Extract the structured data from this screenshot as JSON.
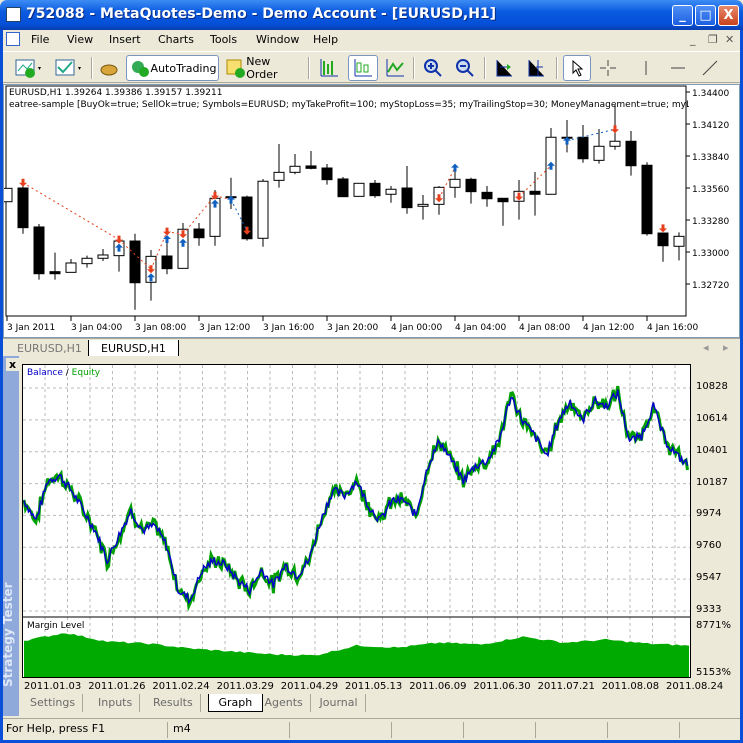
{
  "window": {
    "title": "752088 - MetaQuotes-Demo - Demo Account - [EURUSD,H1]",
    "minimize": "_",
    "maximize": "□",
    "close": "X"
  },
  "menu": [
    "File",
    "View",
    "Insert",
    "Charts",
    "Tools",
    "Window",
    "Help"
  ],
  "toolbar": {
    "autotrading": "AutoTrading",
    "new_order": "New Order"
  },
  "chart": {
    "header": "EURUSD,H1  1.39264 1.39386 1.39157 1.39211",
    "ea_line": "eatree-sample [BuyOk=true; SellOk=true; Symbols=EURUSD; myTakeProfit=100; myStopLoss=35; myTrailingStop=30; MoneyManagement=true; myLots=0.1",
    "price_ticks": [
      "1.34400",
      "1.34120",
      "1.33840",
      "1.33560",
      "1.33280",
      "1.33000",
      "1.32720"
    ],
    "price_range": [
      1.3272,
      1.344
    ],
    "time_ticks": [
      "3 Jan 2011",
      "3 Jan 04:00",
      "3 Jan 08:00",
      "3 Jan 12:00",
      "3 Jan 16:00",
      "3 Jan 20:00",
      "4 Jan 00:00",
      "4 Jan 04:00",
      "4 Jan 08:00",
      "4 Jan 12:00",
      "4 Jan 16:00"
    ],
    "candles": [
      [
        1.3344,
        1.3356,
        1.3344,
        1.33557
      ],
      [
        1.3356,
        1.33601,
        1.3316,
        1.33213
      ],
      [
        1.33219,
        1.33245,
        1.32758,
        1.3281
      ],
      [
        1.32828,
        1.32994,
        1.32758,
        1.3281
      ],
      [
        1.32822,
        1.32939,
        1.32822,
        1.32904
      ],
      [
        1.32898,
        1.32968,
        1.32863,
        1.32945
      ],
      [
        1.32945,
        1.33026,
        1.32921,
        1.32974
      ],
      [
        1.32968,
        1.33131,
        1.32828,
        1.33096
      ],
      [
        1.33096,
        1.3316,
        1.32495,
        1.32731
      ],
      [
        1.32735,
        1.33018,
        1.32574,
        1.32962
      ],
      [
        1.32965,
        1.33079,
        1.32805,
        1.32854
      ],
      [
        1.32857,
        1.33254,
        1.32857,
        1.33199
      ],
      [
        1.33201,
        1.33254,
        1.33055,
        1.33125
      ],
      [
        1.33137,
        1.33543,
        1.33055,
        1.3347
      ],
      [
        1.33484,
        1.3365,
        1.33376,
        1.33475
      ],
      [
        1.33481,
        1.33493,
        1.33099,
        1.33116
      ],
      [
        1.3312,
        1.33639,
        1.33046,
        1.33619
      ],
      [
        1.33627,
        1.33945,
        1.33563,
        1.33697
      ],
      [
        1.33697,
        1.33858,
        1.3368,
        1.3375
      ],
      [
        1.33753,
        1.33884,
        1.33724,
        1.33732
      ],
      [
        1.33735,
        1.3377,
        1.33589,
        1.33633
      ],
      [
        1.33639,
        1.33656,
        1.33484,
        1.33484
      ],
      [
        1.33487,
        1.33601,
        1.33487,
        1.33601
      ],
      [
        1.33601,
        1.3363,
        1.33475,
        1.33493
      ],
      [
        1.33505,
        1.33578,
        1.33431,
        1.33549
      ],
      [
        1.3356,
        1.33753,
        1.33335,
        1.33388
      ],
      [
        1.334,
        1.33499,
        1.33283,
        1.33417
      ],
      [
        1.33417,
        1.33578,
        1.33326,
        1.33566
      ],
      [
        1.33566,
        1.33761,
        1.33475,
        1.33636
      ],
      [
        1.33636,
        1.3365,
        1.33423,
        1.33528
      ],
      [
        1.33522,
        1.33578,
        1.33396,
        1.33466
      ],
      [
        1.3347,
        1.3347,
        1.3323,
        1.3344
      ],
      [
        1.33444,
        1.3363,
        1.33283,
        1.33531
      ],
      [
        1.33531,
        1.337,
        1.33318,
        1.33505
      ],
      [
        1.33505,
        1.34085,
        1.33505,
        1.34004
      ],
      [
        1.34004,
        1.34155,
        1.33872,
        1.34004
      ],
      [
        1.34004,
        1.34111,
        1.33781,
        1.33816
      ],
      [
        1.33802,
        1.34076,
        1.33773,
        1.33925
      ],
      [
        1.33925,
        1.34286,
        1.33895,
        1.33969
      ],
      [
        1.33969,
        1.34059,
        1.33668,
        1.33755
      ],
      [
        1.33759,
        1.33785,
        1.33143,
        1.3316
      ],
      [
        1.33166,
        1.33166,
        1.32915,
        1.33055
      ],
      [
        1.3305,
        1.33172,
        1.32927,
        1.33137
      ]
    ],
    "deals": [
      {
        "bar": 1,
        "type": "sell",
        "price": 1.33606
      },
      {
        "bar": 7,
        "type": "sell",
        "price": 1.33108
      },
      {
        "bar": 7,
        "type": "buy",
        "price": 1.33038
      },
      {
        "bar": 9,
        "type": "sell",
        "price": 1.32849
      },
      {
        "bar": 9,
        "type": "buy",
        "price": 1.32779
      },
      {
        "bar": 10,
        "type": "sell",
        "price": 1.33178
      },
      {
        "bar": 10,
        "type": "buy",
        "price": 1.33114
      },
      {
        "bar": 11,
        "type": "sell",
        "price": 1.33155
      },
      {
        "bar": 11,
        "type": "buy",
        "price": 1.33081
      },
      {
        "bar": 13,
        "type": "sell",
        "price": 1.33493
      },
      {
        "bar": 13,
        "type": "buy",
        "price": 1.33423
      },
      {
        "bar": 14,
        "type": "buy",
        "price": 1.33458
      },
      {
        "bar": 15,
        "type": "sell",
        "price": 1.33186
      },
      {
        "bar": 27,
        "type": "sell",
        "price": 1.3347
      },
      {
        "bar": 28,
        "type": "buy",
        "price": 1.33738
      },
      {
        "bar": 32,
        "type": "sell",
        "price": 1.33484
      },
      {
        "bar": 34,
        "type": "buy",
        "price": 1.33755
      },
      {
        "bar": 35,
        "type": "buy",
        "price": 1.33974
      },
      {
        "bar": 38,
        "type": "sell",
        "price": 1.34074
      },
      {
        "bar": 41,
        "type": "sell",
        "price": 1.33207
      }
    ],
    "deal_lines": [
      [
        0,
        1,
        "#e8401c"
      ],
      [
        1,
        3,
        "#e8401c"
      ],
      [
        3,
        5,
        "#e8401c"
      ],
      [
        5,
        7,
        "#e8401c"
      ],
      [
        7,
        9,
        "#e8401c"
      ],
      [
        9,
        11,
        "#e8401c"
      ],
      [
        11,
        12,
        "#1060c0"
      ],
      [
        13,
        14,
        "#e8401c"
      ],
      [
        15,
        16,
        "#e8401c"
      ],
      [
        17,
        18,
        "#1060c0"
      ]
    ],
    "sell_color": "#e8401c",
    "buy_color": "#1060c0"
  },
  "chart_tabs": [
    "EURUSD,H1",
    "EURUSD,H1"
  ],
  "tester": {
    "sidebar_label": "Strategy Tester",
    "close": "x",
    "balance_label": "Balance",
    "slash": " / ",
    "equity_label": "Equity",
    "balance_color": "#0000c8",
    "equity_color": "#00a000",
    "y_ticks": [
      "10828",
      "10614",
      "10401",
      "10187",
      "9974",
      "9760",
      "9547",
      "9333"
    ],
    "y_range": [
      9333,
      10828
    ],
    "balance": [
      10074,
      9940,
      10207,
      10241,
      10141,
      10007,
      9873,
      9673,
      9840,
      10007,
      9873,
      9907,
      9774,
      9473,
      9406,
      9607,
      9673,
      9640,
      9540,
      9473,
      9607,
      9507,
      9640,
      9574,
      9673,
      9940,
      10141,
      10107,
      10207,
      10040,
      9940,
      10074,
      10074,
      9974,
      10307,
      10474,
      10341,
      10207,
      10307,
      10341,
      10474,
      10775,
      10608,
      10508,
      10374,
      10608,
      10741,
      10608,
      10741,
      10708,
      10795,
      10474,
      10508,
      10708,
      10474,
      10374,
      10307
    ],
    "margin_label": "Margin Level",
    "margin_ticks": [
      "8771%",
      "5153%"
    ],
    "margin_range": [
      5153,
      8771
    ],
    "margin": [
      7501,
      8009,
      7438,
      7311,
      6993,
      6802,
      6612,
      6548,
      7184,
      7057,
      7374,
      7247,
      7755,
      7374,
      7565,
      7311,
      7184
    ],
    "x_ticks": [
      "2011.01.03",
      "2011.01.26",
      "2011.02.24",
      "2011.03.29",
      "2011.04.29",
      "2011.05.13",
      "2011.06.09",
      "2011.06.30",
      "2011.07.21",
      "2011.08.08",
      "2011.08.24"
    ],
    "tabs": [
      "Settings",
      "Inputs",
      "Results",
      "Graph",
      "Agents",
      "Journal"
    ],
    "active_tab": "Graph"
  },
  "status": {
    "help": "For Help, press F1",
    "profile": "m4"
  }
}
